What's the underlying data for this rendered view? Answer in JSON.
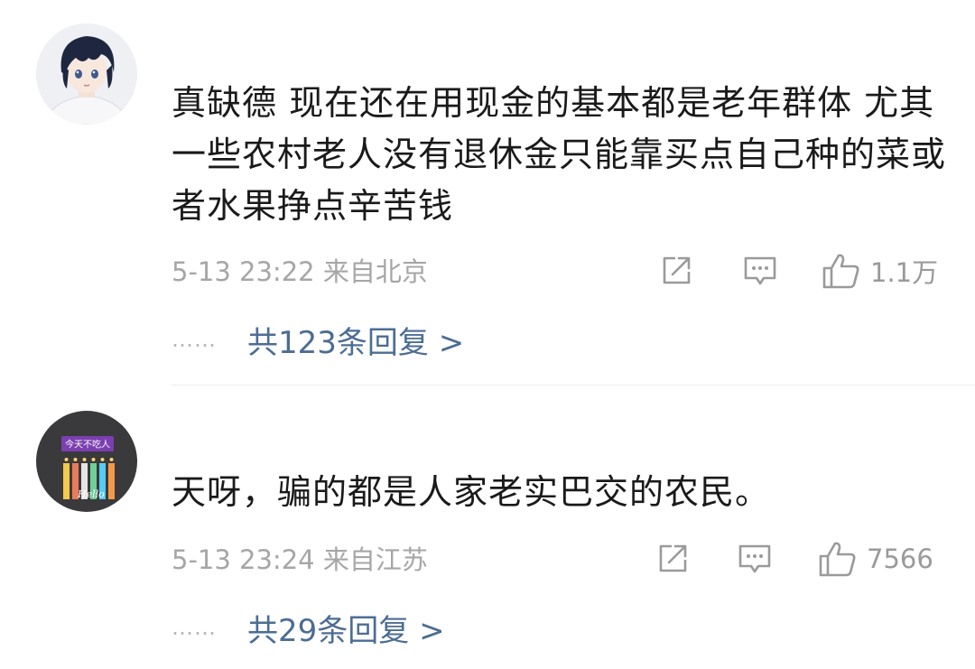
{
  "comments": [
    {
      "text": "真缺德 现在还在用现金的基本都是老年群体 尤其一些农村老人没有退休金只能靠买点自己种的菜或者水果挣点辛苦钱",
      "meta": "5-13 23:22 来自北京",
      "likes": "1.1万",
      "dots": "……",
      "replies": "共123条回复 >",
      "avatar_icon": "anime-boy-avatar"
    },
    {
      "text": "天呀，骗的都是人家老实巴交的农民。",
      "meta": "5-13 23:24 来自江苏",
      "likes": "7566",
      "dots": "……",
      "replies": "共29条回复 >",
      "avatar_icon": "colored-pencils-avatar",
      "avatar_label": "今天不吃人",
      "avatar_script": "Hello"
    }
  ],
  "colors": {
    "text": "#1a1a1a",
    "meta": "#a6a6a6",
    "link": "#4c6d93",
    "icon": "#9a9a9a"
  }
}
